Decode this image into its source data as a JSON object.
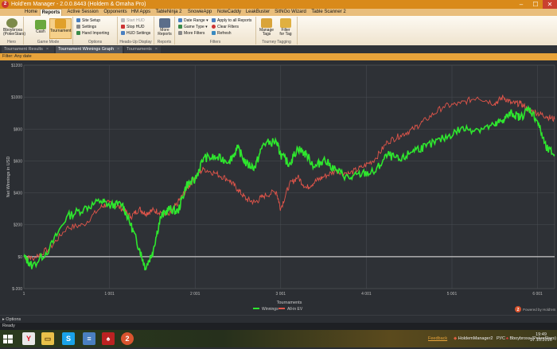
{
  "window": {
    "title": "Hold'em Manager - 2.0.0.8443 (Holdem & Omaha Pro)",
    "icon": "hm2-icon",
    "minimize": "–",
    "maximize": "☐",
    "close": "✕"
  },
  "menu": {
    "tabs": [
      "Home",
      "Reports",
      "Active Session",
      "Opponents",
      "HM Apps",
      "TableNinja 2",
      "SnowieApp",
      "NoteCaddy",
      "LeakBuster",
      "SitNGo Wizard",
      "Table Scanner 2"
    ],
    "active": "Reports"
  },
  "ribbon": {
    "hero": {
      "name_line1": "Bboybroxa",
      "name_line2": "(PokerStars)",
      "label": "Hero"
    },
    "game_mode": {
      "cash": "Cash",
      "tournament": "Tournament",
      "label": "Game Mode"
    },
    "options": {
      "site_setup": "Site Setup",
      "settings": "Settings",
      "hand_importing": "Hand Importing",
      "label": "Options"
    },
    "hud": {
      "start": "Start HUD",
      "stop": "Stop HUD",
      "settings": "HUD Settings",
      "label": "Heads-Up Display"
    },
    "reports": {
      "more_line1": "More",
      "more_line2": "Reports",
      "label": "Reports"
    },
    "filters": {
      "date_range": "Date Range",
      "game_type": "Game Type",
      "more_filters": "More Filters",
      "apply_all": "Apply to all Reports",
      "clear": "Clear Filters",
      "refresh": "Refresh",
      "label": "Filters"
    },
    "tagging": {
      "manage_line1": "Manage",
      "manage_line2": "Tags",
      "filter_line1": "Filter",
      "filter_line2": "for Tag",
      "label": "Tourney Tagging"
    }
  },
  "doc_tabs": [
    "Tournament Results",
    "Tournament Winnings Graph",
    "Tournaments"
  ],
  "doc_tab_active": "Tournament Winnings Graph",
  "filter_text": "Filter: Any date",
  "chart_data": {
    "type": "line",
    "ylabel": "Net Winnings in USD",
    "xlabel": "Tournaments",
    "ylim": [
      -200,
      1200
    ],
    "xlim": [
      1,
      6200
    ],
    "yticks": [
      "$1200",
      "$1000",
      "$800",
      "$600",
      "$400",
      "$200",
      "$0",
      "$-200"
    ],
    "xticks": [
      "1",
      "1 001",
      "2 001",
      "3 001",
      "4 001",
      "5 001",
      "6 001"
    ],
    "grid": true,
    "legend_position": "bottom",
    "series": [
      {
        "name": "Winnings",
        "color": "#2ee62e",
        "x": [
          1,
          100,
          300,
          500,
          700,
          900,
          1000,
          1150,
          1250,
          1350,
          1420,
          1500,
          1600,
          1700,
          1800,
          1900,
          2000,
          2100,
          2250,
          2400,
          2500,
          2600,
          2700,
          2800,
          2950,
          3000,
          3100,
          3200,
          3300,
          3400,
          3500,
          3650,
          3800,
          3950,
          4100,
          4250,
          4400,
          4550,
          4700,
          4900,
          5100,
          5300,
          5500,
          5600,
          5700,
          5800,
          5900,
          6000,
          6100,
          6200
        ],
        "values": [
          0,
          -60,
          50,
          250,
          300,
          350,
          320,
          330,
          200,
          50,
          -70,
          20,
          250,
          300,
          280,
          450,
          480,
          620,
          620,
          600,
          680,
          580,
          560,
          710,
          720,
          640,
          580,
          680,
          640,
          560,
          610,
          540,
          490,
          520,
          530,
          640,
          600,
          670,
          690,
          740,
          800,
          800,
          820,
          860,
          900,
          870,
          930,
          850,
          680,
          640
        ]
      },
      {
        "name": "All-in EV",
        "color": "#e2554a",
        "x": [
          1,
          100,
          300,
          500,
          700,
          900,
          1000,
          1150,
          1250,
          1350,
          1420,
          1500,
          1600,
          1700,
          1800,
          1900,
          2000,
          2100,
          2250,
          2400,
          2500,
          2600,
          2700,
          2800,
          2950,
          3000,
          3100,
          3200,
          3300,
          3400,
          3500,
          3650,
          3800,
          3950,
          4100,
          4250,
          4400,
          4550,
          4700,
          4900,
          5100,
          5300,
          5500,
          5600,
          5700,
          5800,
          5900,
          6000,
          6100,
          6200
        ],
        "values": [
          0,
          -10,
          50,
          180,
          200,
          310,
          340,
          300,
          250,
          300,
          270,
          290,
          280,
          260,
          340,
          420,
          500,
          550,
          520,
          480,
          420,
          360,
          340,
          380,
          410,
          300,
          450,
          500,
          430,
          470,
          500,
          540,
          520,
          560,
          610,
          720,
          760,
          800,
          860,
          940,
          960,
          1000,
          960,
          1000,
          960,
          960,
          920,
          900,
          880,
          860
        ]
      }
    ],
    "watermark": "Powered by Hold'em Manager"
  },
  "options_label": "Options",
  "status_text": "Ready",
  "taskbar": {
    "feedback": "Feedback",
    "app1": "HoldemManager2",
    "app2": "Bboybroxa (PokerStars)",
    "lang": "РУС",
    "time": "19:49",
    "date": "27.10.2016"
  },
  "colors": {
    "accent": "#e8a33a",
    "title": "#d98a1a",
    "chart_bg": "#2b2e33",
    "grid": "#4a4e55",
    "zero": "#c8c8c8"
  }
}
